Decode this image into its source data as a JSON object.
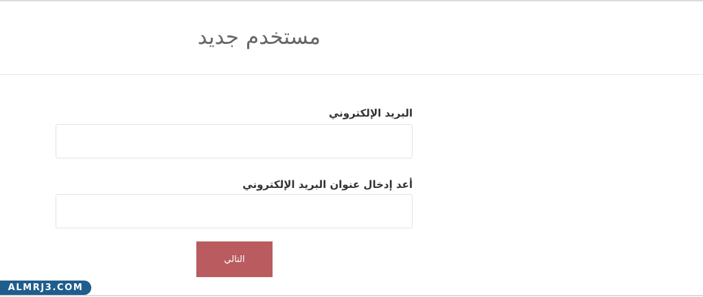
{
  "header": {
    "title": "مستخدم جديد"
  },
  "form": {
    "email_label": "البريد الإلكتروني",
    "email_value": "",
    "confirm_label": "أعد إدخال عنوان البريد الإلكتروني",
    "confirm_value": "",
    "next_label": "التالي"
  },
  "watermark": {
    "text": "ALMRJ3.COM"
  },
  "colors": {
    "button": "#b95b5f",
    "title": "#666666",
    "label": "#333333",
    "watermark": "#1f5d8c"
  }
}
